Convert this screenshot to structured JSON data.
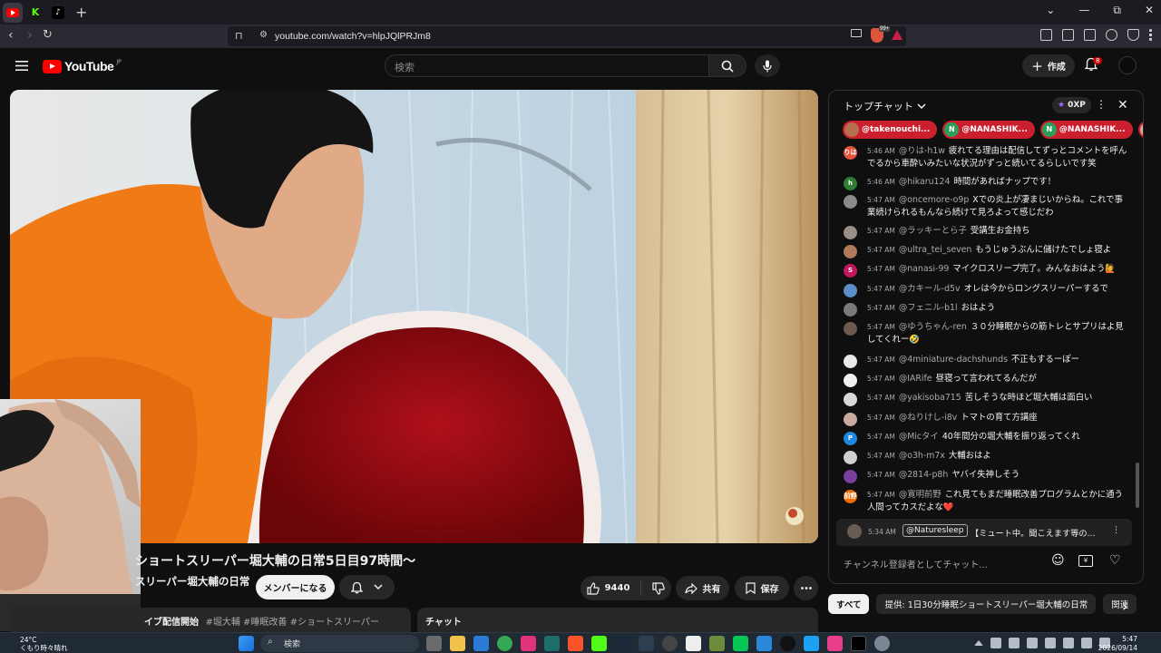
{
  "browser": {
    "url": "youtube.com/watch?v=hlpJQlPRJm8",
    "new_tab": "+",
    "window_controls": [
      "⌄",
      "—",
      "⧉",
      "✕"
    ],
    "extension_badge": "99+"
  },
  "youtube": {
    "logo_text": "YouTube",
    "region": "JP",
    "search_placeholder": "検索",
    "create_label": "作成",
    "notification_count": "8"
  },
  "video": {
    "title": "ショートスリーパー堀大輔の日常5日目97時間〜",
    "channel": "スリーパー堀大輔の日常",
    "member_button": "メンバーになる",
    "like_count": "9440",
    "share_label": "共有",
    "save_label": "保存",
    "description": "イブ配信開始",
    "tags": "#堀大輔 #睡眠改善 #ショートスリーパー",
    "chat_replay_label": "チャット"
  },
  "chat": {
    "title": "トップチャット",
    "xp": "0XP",
    "tickers": [
      {
        "name": "@takenouchi...",
        "color": "#b5704f"
      },
      {
        "name": "@NANASHIK...",
        "color": "#2e9e5b"
      },
      {
        "name": "@NANASHIK...",
        "color": "#2e9e5b"
      },
      {
        "name": "@a",
        "color": "#d4a89a"
      }
    ],
    "messages": [
      {
        "time": "5:46 AM",
        "author": "@りは-h1w",
        "text": "疲れてる理由は配信してずっとコメントを呼んでるから車酔いみたいな状況がずっと続いてるらしいです笑",
        "avatar": "りは",
        "color": "#e0533c"
      },
      {
        "time": "5:46 AM",
        "author": "@hikaru124",
        "text": "時間があればナップです！",
        "avatar": "h",
        "color": "#2e7d32"
      },
      {
        "time": "5:47 AM",
        "author": "@oncemore-o9p",
        "text": "Xでの炎上が凄まじいからね。これで事業続けられるもんなら続けて見ろよって感じだわ",
        "avatar": "",
        "color": "#8a8a8a"
      },
      {
        "time": "5:47 AM",
        "author": "@ラッキーとら子",
        "text": "受講生お金持ち",
        "avatar": "",
        "color": "#9a8f86"
      },
      {
        "time": "5:47 AM",
        "author": "@ultra_tei_seven",
        "text": "もうじゅうぶんに儲けたでしょ寝よ",
        "avatar": "",
        "color": "#b07a5a"
      },
      {
        "time": "5:47 AM",
        "author": "@nanasi-99",
        "text": "マイクロスリープ完了。みんなおはよう🙋",
        "avatar": "S",
        "color": "#c2185b"
      },
      {
        "time": "5:47 AM",
        "author": "@カキール-d5v",
        "text": "オレは今からロングスリーパーするで",
        "avatar": "",
        "color": "#5b8fc9"
      },
      {
        "time": "5:47 AM",
        "author": "@フェニル-b1l",
        "text": "おはよう",
        "avatar": "",
        "color": "#7a7a7a"
      },
      {
        "time": "5:47 AM",
        "author": "@ゆうちゃん-ren",
        "text": "３０分睡眠からの筋トレとサプリはよ見してくれー🤣",
        "avatar": "",
        "color": "#6d5a4e"
      },
      {
        "time": "5:47 AM",
        "author": "@4miniature-dachshunds",
        "text": "不正もするーぽー",
        "avatar": "",
        "color": "#e8e8e8"
      },
      {
        "time": "5:47 AM",
        "author": "@IARife",
        "text": "昼寝って言われてるんだが",
        "avatar": "",
        "color": "#f0f0f0"
      },
      {
        "time": "5:47 AM",
        "author": "@yakisoba715",
        "text": "苦しそうな時ほど堀大輔は面白い",
        "avatar": "",
        "color": "#d8d8d8"
      },
      {
        "time": "5:47 AM",
        "author": "@ねりけし-i8v",
        "text": "トマトの育て方講座",
        "avatar": "",
        "color": "#c9a9a0"
      },
      {
        "time": "5:47 AM",
        "author": "@Micタイ",
        "text": "40年間分の堀大輔を振り返ってくれ",
        "avatar": "P",
        "color": "#1e88e5"
      },
      {
        "time": "5:47 AM",
        "author": "@o3h-m7x",
        "text": "大輔おはよ",
        "avatar": "",
        "color": "#d0d0d0"
      },
      {
        "time": "5:47 AM",
        "author": "@2814-p8h",
        "text": "ヤバイ失神しそう",
        "avatar": "",
        "color": "#7b3fa0"
      },
      {
        "time": "5:47 AM",
        "author": "@寛明前野",
        "text": "これ見てもまだ睡眠改善プログラムとかに通う人間ってカスだよな❤️",
        "avatar": "前野",
        "color": "#ef6c00"
      }
    ],
    "pinned": {
      "time": "5:34 AM",
      "author": "@Naturesleep",
      "text": "【ミュート中。聞こえます等の..."
    },
    "input_placeholder": "チャンネル登録者としてチャット..."
  },
  "chips": [
    "すべて",
    "提供: 1日30分睡眠ショートスリーパー堀大輔の日常",
    "関連"
  ],
  "taskbar": {
    "temperature": "24°C",
    "weather": "くもり時々晴れ",
    "search": "検索",
    "time": "5:47",
    "date": "2026/09/14"
  }
}
